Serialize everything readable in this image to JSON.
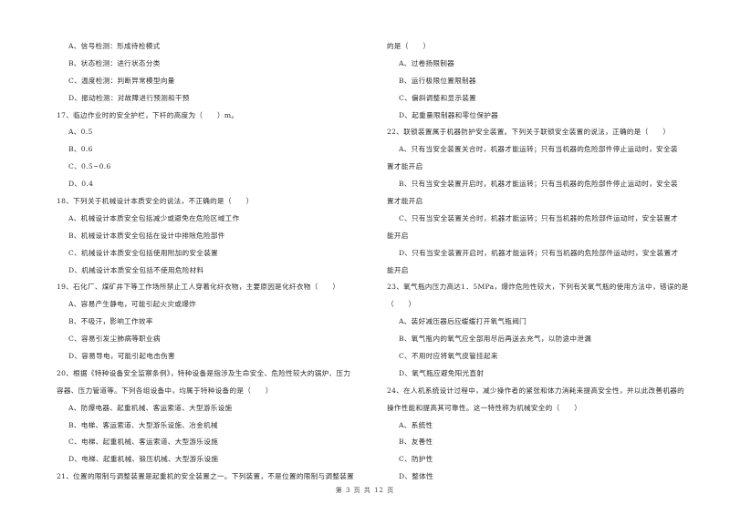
{
  "left_column": [
    {
      "type": "option",
      "text": "A、信号检测：形成待检模式"
    },
    {
      "type": "option",
      "text": "B、状态检测：进行状态分类"
    },
    {
      "type": "option",
      "text": "C、温度检测：判断异常模型向量"
    },
    {
      "type": "option",
      "text": "D、振动检测：对故障进行预测和干预"
    },
    {
      "type": "question",
      "text": "17、临边作业时的安全护栏，下杆的高度为（　　）m。"
    },
    {
      "type": "option",
      "text": "A、0.5"
    },
    {
      "type": "option",
      "text": "B、0.6"
    },
    {
      "type": "option",
      "text": "C、0.5~0.6"
    },
    {
      "type": "option",
      "text": "D、0.4"
    },
    {
      "type": "question",
      "text": "18、下列关于机械设计本质安全的说法，不正确的是（　　）"
    },
    {
      "type": "option",
      "text": "A、机械设计本质安全包括减少或避免在危险区域工作"
    },
    {
      "type": "option",
      "text": "B、机械设计本质安全包括在设计中排除危险部件"
    },
    {
      "type": "option",
      "text": "C、机械设计本质安全包括使用附加的安全装置"
    },
    {
      "type": "option",
      "text": "D、机械设计本质安全包括不使用危险材料"
    },
    {
      "type": "question",
      "text": "19、石化厂、煤矿井下等工作场所禁止工人穿着化纤衣物，主要原因是化纤衣物（　　）"
    },
    {
      "type": "option",
      "text": "A、容易产生静电，可能引起火灾或爆炸"
    },
    {
      "type": "option",
      "text": "B、不吸汗，影响工作效率"
    },
    {
      "type": "option",
      "text": "C、容易引发尘肺病等职业病"
    },
    {
      "type": "option",
      "text": "D、容易导电，可能引起电击伤害"
    },
    {
      "type": "question",
      "text": "20、根据《特种设备安全监察条例》，特种设备是指涉及生命安全、危险性较大的锅炉、压力"
    },
    {
      "type": "question",
      "text": "容器、压力管道等。下列各组设备中，均属于特种设备的是（　　）"
    },
    {
      "type": "option",
      "text": "A、防爆电器、起重机械、客运索道、大型游乐设施"
    },
    {
      "type": "option",
      "text": "B、电梯、客运索道、大型游乐设施、冶金机械"
    },
    {
      "type": "option",
      "text": "C、电梯、起重机械、客运索道、大型游乐设施"
    },
    {
      "type": "option",
      "text": "D、电梯、起重机械、锻压机械、大型游乐设施"
    },
    {
      "type": "question",
      "text": "21、位置的限制与调整装置是起重机的安全装置之一。下列装置，不是位置的限制与调整装置"
    }
  ],
  "right_column": [
    {
      "type": "question",
      "text": "的是（　　）"
    },
    {
      "type": "option",
      "text": "A、过卷扬限制器"
    },
    {
      "type": "option",
      "text": "B、运行极限位置限制器"
    },
    {
      "type": "option",
      "text": "C、偏斜调整和显示装置"
    },
    {
      "type": "option",
      "text": "D、起重量限制器和零位保护器"
    },
    {
      "type": "question",
      "text": "22、联锁装置属于机器防护安全装置。下列关于联锁安全装置的说法，正确的是（　　）"
    },
    {
      "type": "option",
      "text": "A、只有当安全装置关合时，机器才能运转；只有当机器的危险部件停止运动时，安全装"
    },
    {
      "type": "question",
      "text": "置才能开启"
    },
    {
      "type": "option",
      "text": "B、只有当安全装置开启时，机器才能运转；只有当机器的危险部件停止运动时，安全装"
    },
    {
      "type": "question",
      "text": "置才能开启"
    },
    {
      "type": "option",
      "text": "C、只有当安全装置关合时，机器才能运转；只有当机器的危险部件运动时，安全装置才"
    },
    {
      "type": "question",
      "text": "能开启"
    },
    {
      "type": "option",
      "text": "D、只有当安全装置开启时，机器才能运转；只有当机器的危险部件运动时，安全装置才"
    },
    {
      "type": "question",
      "text": "能开启"
    },
    {
      "type": "question",
      "text": "23、氧气瓶内压力高达1．5MPa，爆炸危险性较大，下列有关氧气瓶的使用方法中，错误的是"
    },
    {
      "type": "question",
      "text": "（　　）"
    },
    {
      "type": "option",
      "text": "A、装好减压器后应缓缓打开氧气瓶阀门"
    },
    {
      "type": "option",
      "text": "B、氧气瓶内的氧气应全部用尽后再送去充气，以防途中泄漏"
    },
    {
      "type": "option",
      "text": "C、不用时应将氧气皮管挂起来"
    },
    {
      "type": "option",
      "text": "D、氧气瓶应避免阳光直射"
    },
    {
      "type": "question",
      "text": "24、在人机系统设计过程中，减少操作者的紧张和体力消耗来提高安全性，并以此改善机器的"
    },
    {
      "type": "question",
      "text": "操作性能和提高其可靠性。这一特性称为机械安全的（　　）"
    },
    {
      "type": "option",
      "text": "A、系统性"
    },
    {
      "type": "option",
      "text": "B、友善性"
    },
    {
      "type": "option",
      "text": "C、防护性"
    },
    {
      "type": "option",
      "text": "D、整体性"
    }
  ],
  "footer": {
    "page_label": "第 3 页 共 12 页"
  }
}
